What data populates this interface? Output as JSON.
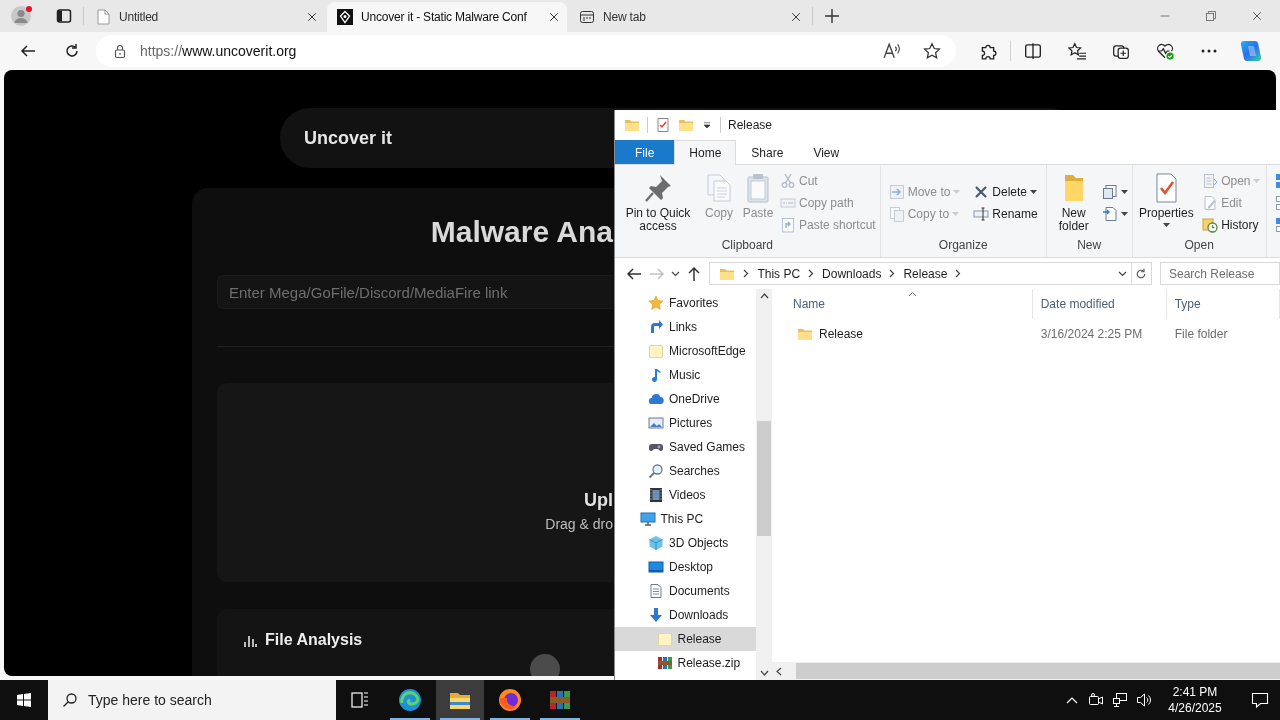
{
  "browser": {
    "tabs": [
      {
        "title": "Untitled",
        "kind": "document",
        "selected": false
      },
      {
        "title": "Uncover it - Static Malware Conf",
        "kind": "site",
        "selected": true
      },
      {
        "title": "New tab",
        "kind": "newtab",
        "selected": false
      }
    ],
    "address": {
      "scheme": "https://",
      "host": "www.uncoverit.org"
    }
  },
  "web_page": {
    "brand": "Uncover it",
    "title": "Malware Ana",
    "link_input": {
      "placeholder": "Enter Mega/GoFile/Discord/MediaFire link"
    },
    "upload": {
      "heading": "Upl",
      "hint": "Drag & dro"
    },
    "file_analysis": {
      "heading": "File Analysis"
    }
  },
  "explorer": {
    "title": "Release",
    "ribbon_tabs": [
      {
        "label": "File",
        "kind": "file",
        "selected": false
      },
      {
        "label": "Home",
        "kind": "tab",
        "selected": true
      },
      {
        "label": "Share",
        "kind": "tab",
        "selected": false
      },
      {
        "label": "View",
        "kind": "tab",
        "selected": false
      }
    ],
    "ribbon_groups": [
      {
        "label": "Clipboard",
        "columns": [
          [
            {
              "label": "Pin to Quick access",
              "kind": "pin",
              "disabled": false
            }
          ],
          [
            {
              "label": "Copy",
              "kind": "copy",
              "disabled": true
            }
          ],
          [
            {
              "label": "Paste",
              "kind": "paste",
              "disabled": true
            }
          ],
          [
            {
              "label": "Cut",
              "kind": "cut",
              "disabled": true
            },
            {
              "label": "Copy path",
              "kind": "copy-path",
              "disabled": true
            },
            {
              "label": "Paste shortcut",
              "kind": "paste-shortcut",
              "disabled": true
            }
          ]
        ]
      },
      {
        "label": "Organize",
        "columns": [
          [
            {
              "label": "Move to",
              "kind": "move-to",
              "disabled": true,
              "dropdown": true
            },
            {
              "label": "Copy to",
              "kind": "copy-to",
              "disabled": true,
              "dropdown": true
            }
          ],
          [
            {
              "label": "Delete",
              "kind": "delete",
              "disabled": false,
              "dropdown": true
            },
            {
              "label": "Rename",
              "kind": "rename",
              "disabled": false
            }
          ]
        ]
      },
      {
        "label": "New",
        "columns": [
          [
            {
              "label": "New folder",
              "kind": "new-folder",
              "disabled": false
            }
          ],
          [
            {
              "kind": "new-item",
              "disabled": false,
              "dropdown": true
            },
            {
              "kind": "easy-access",
              "disabled": false,
              "dropdown": true
            }
          ]
        ]
      },
      {
        "label": "Open",
        "columns": [
          [
            {
              "label": "Properties",
              "kind": "properties",
              "disabled": false,
              "dropdown": true
            }
          ],
          [
            {
              "label": "Open",
              "kind": "open",
              "disabled": true,
              "dropdown": true
            },
            {
              "label": "Edit",
              "kind": "edit",
              "disabled": true
            },
            {
              "label": "History",
              "kind": "history",
              "disabled": false
            }
          ]
        ]
      },
      {
        "columns": [
          [
            {
              "kind": "select-all"
            },
            {
              "kind": "select-none"
            },
            {
              "kind": "invert-selection"
            }
          ]
        ]
      }
    ],
    "nav_buttons": [
      {
        "kind": "back",
        "disabled": false
      },
      {
        "kind": "forward",
        "disabled": true
      },
      {
        "kind": "recent",
        "disabled": false
      },
      {
        "kind": "up",
        "disabled": false
      }
    ],
    "breadcrumbs": [
      "This PC",
      "Downloads",
      "Release"
    ],
    "search": {
      "placeholder": "Search Release"
    },
    "nav_pane": [
      {
        "children": [
          {
            "label": "Favorites",
            "kind": "favorites",
            "selected": false
          },
          {
            "label": "Links",
            "kind": "links",
            "selected": false
          },
          {
            "label": "MicrosoftEdge",
            "kind": "folder",
            "selected": false
          },
          {
            "label": "Music",
            "kind": "music",
            "selected": false
          },
          {
            "label": "OneDrive",
            "kind": "cloud",
            "selected": false
          },
          {
            "label": "Pictures",
            "kind": "pictures",
            "selected": false
          },
          {
            "label": "Saved Games",
            "kind": "games",
            "selected": false
          },
          {
            "label": "Searches",
            "kind": "searches",
            "selected": false
          },
          {
            "label": "Videos",
            "kind": "videos",
            "selected": false
          }
        ]
      },
      {
        "label": "This PC",
        "kind": "computer",
        "selected": false,
        "children": [
          {
            "label": "3D Objects",
            "kind": "cube",
            "selected": false
          },
          {
            "label": "Desktop",
            "kind": "desktop",
            "selected": false
          },
          {
            "label": "Documents",
            "kind": "documents",
            "selected": false
          },
          {
            "label": "Downloads",
            "kind": "downloads",
            "selected": false,
            "children": [
              {
                "label": "Release",
                "kind": "folder",
                "selected": true
              },
              {
                "label": "Release.zip",
                "kind": "archive",
                "selected": false
              }
            ]
          }
        ]
      }
    ],
    "files": {
      "columns": [
        {
          "label": "Name",
          "sorted": true
        },
        {
          "label": "Date modified",
          "sorted": false
        },
        {
          "label": "Type",
          "sorted": false
        }
      ],
      "rows": [
        {
          "name": "Release",
          "date": "3/16/2024 2:25 PM",
          "type": "File folder",
          "kind": "folder"
        }
      ]
    }
  },
  "taskbar": {
    "search": {
      "placeholder": "Type here to search"
    },
    "apps": [
      {
        "kind": "task-view",
        "running": false,
        "selected": false
      },
      {
        "kind": "browser",
        "running": true,
        "selected": false
      },
      {
        "kind": "file-explorer",
        "running": true,
        "selected": true
      },
      {
        "kind": "fox",
        "running": true,
        "selected": false
      },
      {
        "kind": "archiver",
        "running": true,
        "selected": false
      }
    ],
    "time": "2:41 PM",
    "date": "4/26/2025"
  }
}
